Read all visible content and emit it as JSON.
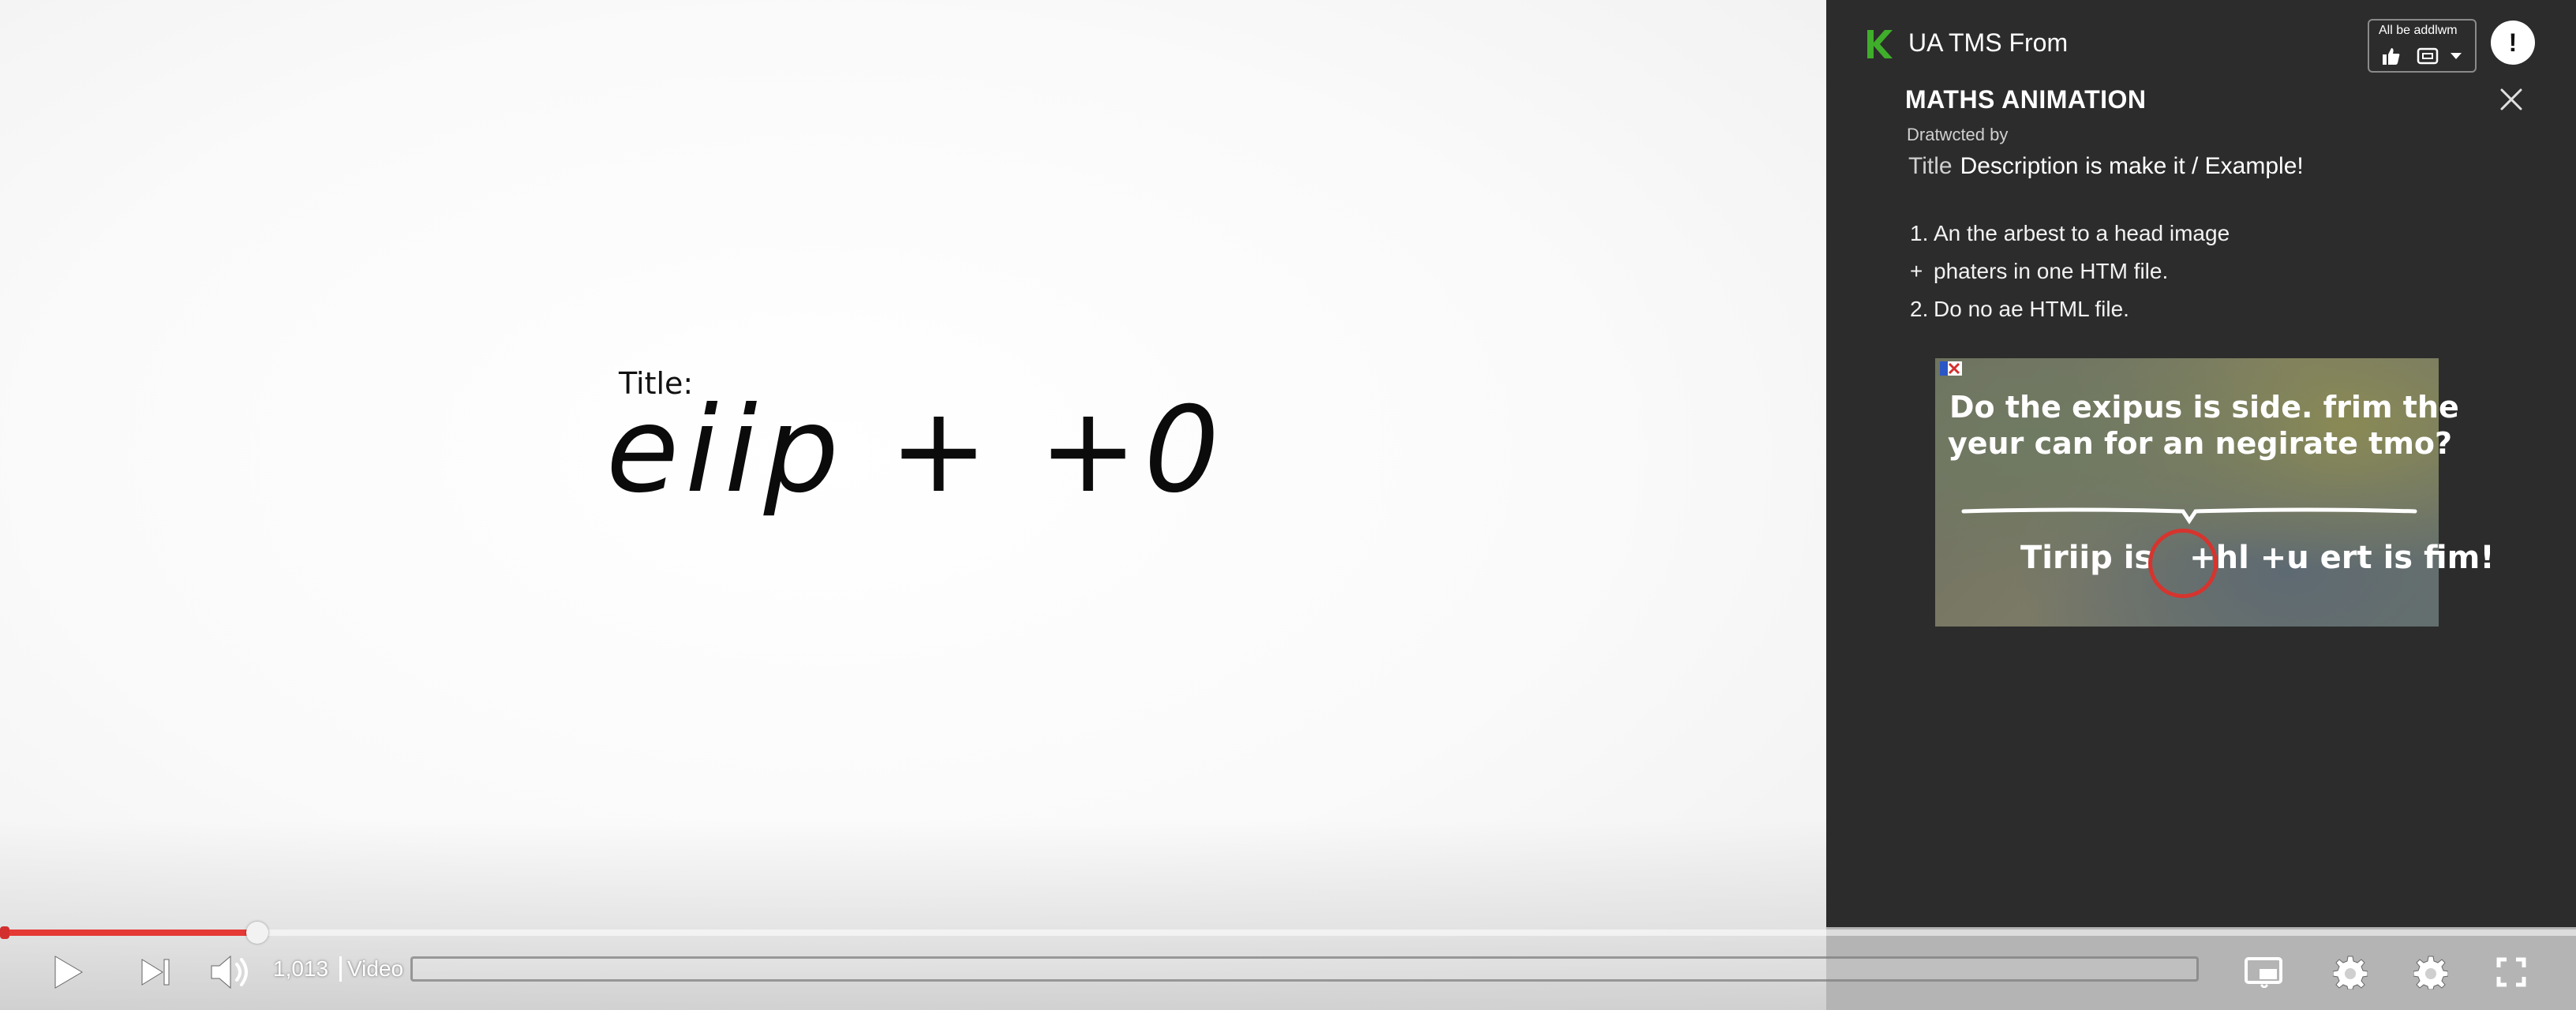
{
  "video": {
    "hand_title": "Title:",
    "hand_expression": "eiip + +0"
  },
  "controls": {
    "time": "1,013",
    "label": "Video",
    "progress_fraction": 0.1
  },
  "panel": {
    "brand_name": "UA TMS From",
    "widget_text": "All be addlwm",
    "alert_symbol": "!",
    "title": "MATHS ANIMATION",
    "by_line": "Dratwcted by",
    "desc_label": "Title",
    "desc_text": "Description is make it / Example!",
    "list": [
      {
        "marker": "1.",
        "text": "An the arbest to a head image"
      },
      {
        "marker": "+",
        "text": "phaters in one HTM file."
      },
      {
        "marker": "2.",
        "text": "Do no ae HTML file."
      }
    ],
    "thumbnail": {
      "line1": "Do the exipus is side. frim the",
      "line2": "yeur can for an negirate tmo?",
      "line3_pre": "Tiriip is",
      "line3_circled": "+hl",
      "line3_post": "+u ert is fim!"
    }
  },
  "colors": {
    "progress": "#e53935",
    "panel_bg": "#2c2c2c",
    "brand": "#3fae2a",
    "circle": "#d6342e"
  }
}
